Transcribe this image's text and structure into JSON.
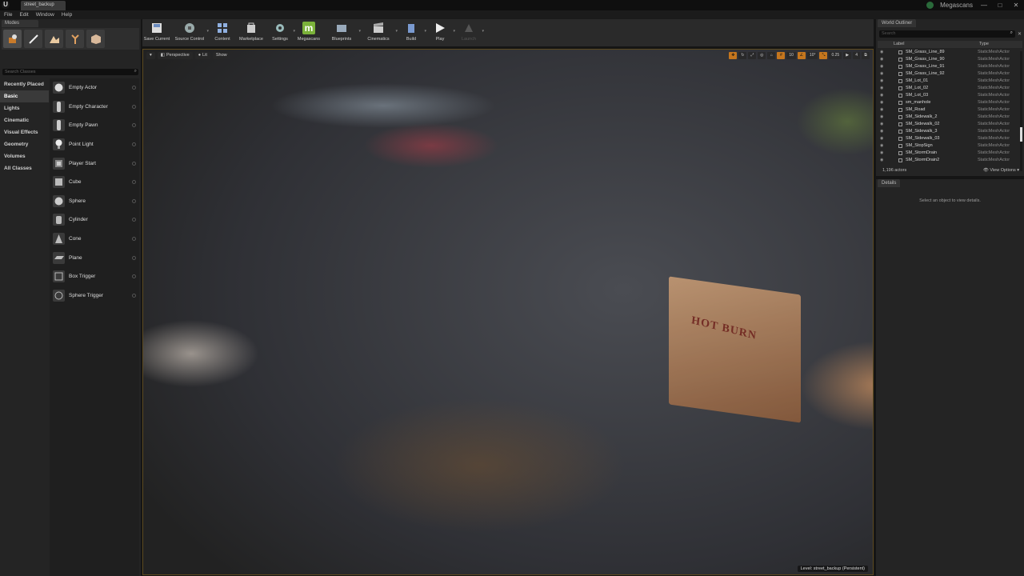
{
  "titlebar": {
    "logo": "U",
    "level_tab": "street_backup",
    "brand": "Megascans",
    "window_controls": [
      "—",
      "□",
      "✕"
    ]
  },
  "menu": [
    "File",
    "Edit",
    "Window",
    "Help"
  ],
  "modes": {
    "tab": "Modes",
    "search_placeholder": "Search Classes",
    "categories": [
      "Recently Placed",
      "Basic",
      "Lights",
      "Cinematic",
      "Visual Effects",
      "Geometry",
      "Volumes",
      "All Classes"
    ],
    "selected_category": "Basic",
    "items": [
      "Empty Actor",
      "Empty Character",
      "Empty Pawn",
      "Point Light",
      "Player Start",
      "Cube",
      "Sphere",
      "Cylinder",
      "Cone",
      "Plane",
      "Box Trigger",
      "Sphere Trigger"
    ]
  },
  "toolbar": {
    "buttons": [
      "Save Current",
      "Source Control",
      "Content",
      "Marketplace",
      "Settings",
      "Megascans",
      "Blueprints",
      "Cinematics",
      "Build",
      "Play",
      "Launch"
    ]
  },
  "viewport": {
    "perspective": "Perspective",
    "lit": "Lit",
    "show": "Show",
    "grid_snap": "10",
    "rot_snap": "10°",
    "scale_snap": "0.25",
    "cam_speed": "4",
    "level_label": "Level: street_backup (Persistent)",
    "prop_text": "HOT BURN"
  },
  "outliner": {
    "tab": "World Outliner",
    "search_placeholder": "Search",
    "col_label": "Label",
    "col_type": "Type",
    "rows": [
      {
        "label": "SM_Grass_Line_89",
        "type": "StaticMeshActor"
      },
      {
        "label": "SM_Grass_Line_90",
        "type": "StaticMeshActor"
      },
      {
        "label": "SM_Grass_Line_91",
        "type": "StaticMeshActor"
      },
      {
        "label": "SM_Grass_Line_92",
        "type": "StaticMeshActor"
      },
      {
        "label": "SM_Lot_01",
        "type": "StaticMeshActor"
      },
      {
        "label": "SM_Lot_02",
        "type": "StaticMeshActor"
      },
      {
        "label": "SM_Lot_03",
        "type": "StaticMeshActor"
      },
      {
        "label": "sm_manhole",
        "type": "StaticMeshActor"
      },
      {
        "label": "SM_Road",
        "type": "StaticMeshActor"
      },
      {
        "label": "SM_Sidewalk_2",
        "type": "StaticMeshActor"
      },
      {
        "label": "SM_Sidewalk_02",
        "type": "StaticMeshActor"
      },
      {
        "label": "SM_Sidewalk_3",
        "type": "StaticMeshActor"
      },
      {
        "label": "SM_Sidewalk_03",
        "type": "StaticMeshActor"
      },
      {
        "label": "SM_StopSign",
        "type": "StaticMeshActor"
      },
      {
        "label": "SM_StormDrain",
        "type": "StaticMeshActor"
      },
      {
        "label": "SM_StormDrain2",
        "type": "StaticMeshActor"
      }
    ],
    "actor_count": "1,196 actors",
    "view_options": "View Options"
  },
  "details": {
    "tab": "Details",
    "empty_message": "Select an object to view details."
  },
  "colors": {
    "accent_orange": "#c4761e",
    "megascans_green": "#7bb23a"
  }
}
